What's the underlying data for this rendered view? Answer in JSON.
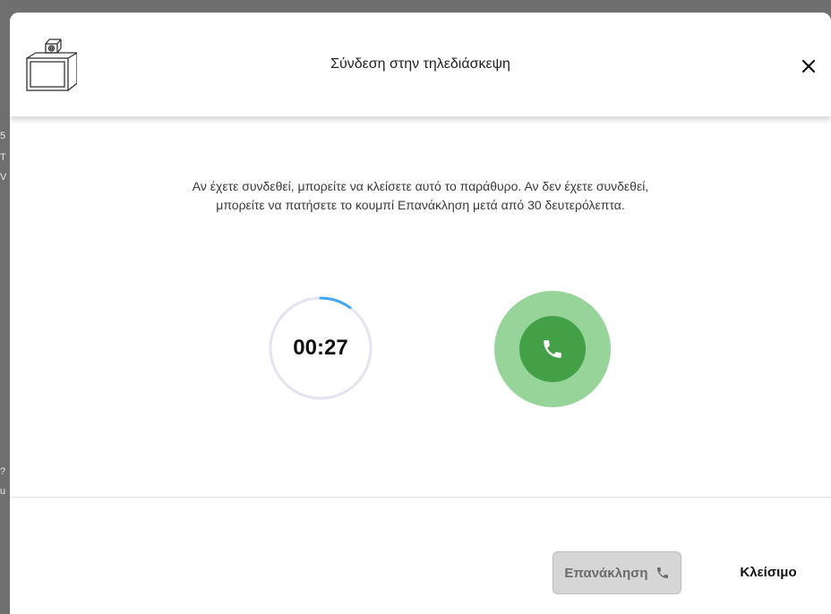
{
  "dialog": {
    "title": "Σύνδεση στην τηλεδιάσκεψη",
    "header_icon": "webcam-monitor-icon",
    "close_icon": "close-icon"
  },
  "body": {
    "message_line1": "Αν έχετε συνδεθεί, μπορείτε να κλείσετε αυτό το παράθυρο. Αν δεν έχετε συνδεθεί,",
    "message_line2": "μπορείτε να πατήσετε το κουμπί Επανάκληση μετά από 30 δευτερόλεπτα.",
    "timer": "00:27",
    "countdown_progress": 0.1,
    "call_icon": "phone-icon"
  },
  "footer": {
    "redial_label": "Επανάκληση",
    "redial_icon": "phone-icon",
    "redial_disabled": true,
    "close_label": "Κλείσιμο"
  },
  "colors": {
    "accent_ring": "#42a5f5",
    "ring_track": "#e3e4f2",
    "call_outer": "#97d49a",
    "call_inner": "#43a047"
  }
}
